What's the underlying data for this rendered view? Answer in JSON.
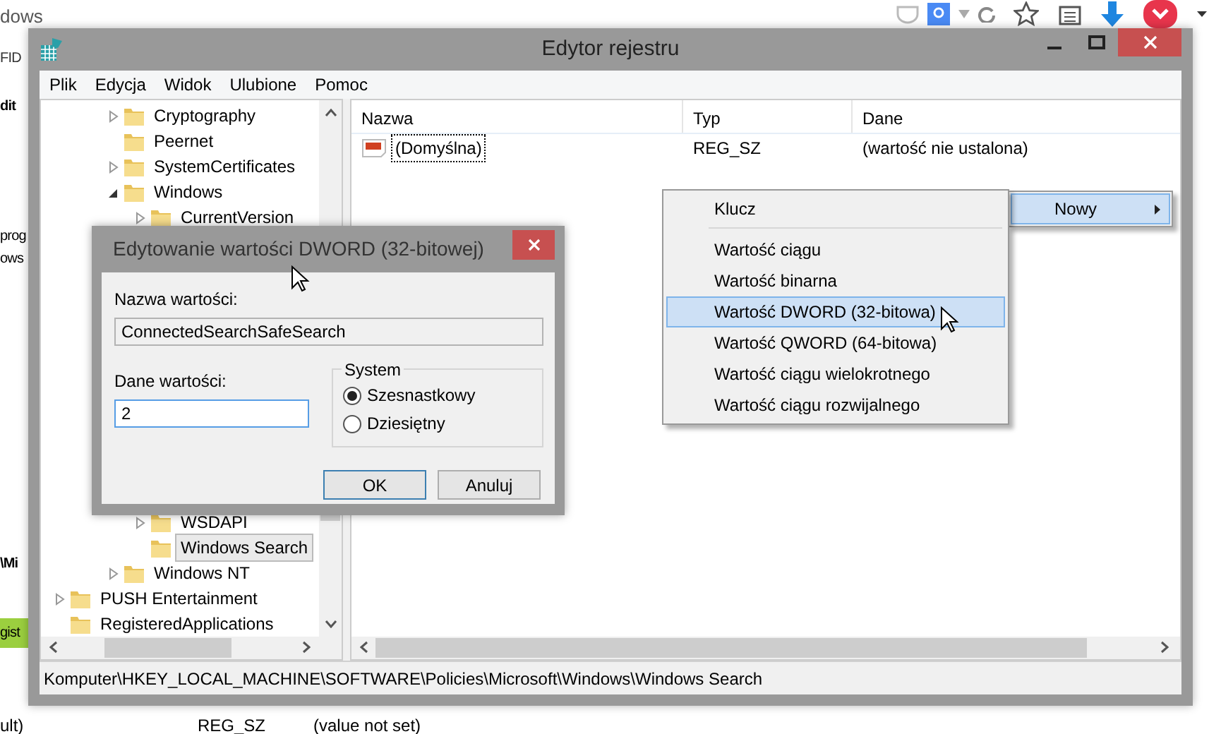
{
  "browser": {
    "title_fragment": "dows",
    "fragments": [
      {
        "text": "FID",
        "kind": "brand"
      },
      {
        "text": "dit",
        "kind": "heading"
      },
      {
        "text": "prog",
        "kind": "text"
      },
      {
        "text": "ows",
        "kind": "text"
      },
      {
        "text": "\\Mi",
        "kind": "heading"
      },
      {
        "text": "gist",
        "kind": "button"
      }
    ],
    "bottom_row": [
      "ult)",
      "REG_SZ",
      "(value not set)"
    ]
  },
  "window": {
    "title": "Edytor rejestru"
  },
  "menu": [
    "Plik",
    "Edycja",
    "Widok",
    "Ulubione",
    "Pomoc"
  ],
  "tree": [
    {
      "children": [
        {
          "children": [
            {
              "label": "Cryptography",
              "expanded": false,
              "selected": false
            },
            {
              "label": "Peernet",
              "selected": false
            },
            {
              "label": "SystemCertificates",
              "expanded": false,
              "selected": false
            },
            {
              "label": "Windows",
              "expanded": true,
              "selected": false,
              "children": [
                {
                  "label": "CurrentVersion",
                  "expanded": false,
                  "selected": false
                },
                {
                  "label": "WSDAPI",
                  "expanded": false,
                  "selected": false
                },
                {
                  "label": "Windows Search",
                  "selected": true
                }
              ]
            },
            {
              "label": "Windows NT",
              "expanded": false,
              "selected": false
            }
          ]
        }
      ]
    },
    {
      "label": "PUSH Entertainment",
      "expanded": false,
      "selected": false
    },
    {
      "label": "RegisteredApplications",
      "selected": false
    }
  ],
  "list": {
    "columns": [
      "Nazwa",
      "Typ",
      "Dane"
    ],
    "rows": [
      {
        "name": "(Domyślna)",
        "type": "REG_SZ",
        "data": "(wartość nie ustalona)",
        "focused": true
      }
    ]
  },
  "context_menu": {
    "item": {
      "label": "Nowy",
      "selected": true
    },
    "submenu": [
      {
        "kind": "item",
        "label": "Klucz",
        "selected": false
      },
      {
        "kind": "separator"
      },
      {
        "kind": "item",
        "label": "Wartość ciągu",
        "selected": false
      },
      {
        "kind": "item",
        "label": "Wartość binarna",
        "selected": false
      },
      {
        "kind": "item",
        "label": "Wartość DWORD (32-bitowa)",
        "selected": true
      },
      {
        "kind": "item",
        "label": "Wartość QWORD (64-bitowa)",
        "selected": false
      },
      {
        "kind": "item",
        "label": "Wartość ciągu wielokrotnego",
        "selected": false
      },
      {
        "kind": "item",
        "label": "Wartość ciągu rozwijalnego",
        "selected": false
      }
    ]
  },
  "status_bar": "Komputer\\HKEY_LOCAL_MACHINE\\SOFTWARE\\Policies\\Microsoft\\Windows\\Windows Search",
  "dialog": {
    "title": "Edytowanie wartości DWORD (32-bitowej)",
    "name_label": "Nazwa wartości:",
    "name_value": "ConnectedSearchSafeSearch",
    "data_label": "Dane wartości:",
    "data_value": "2",
    "base_group": "System",
    "bases": [
      {
        "label": "Szesnastkowy",
        "selected": true
      },
      {
        "label": "Dziesiętny",
        "selected": false
      }
    ],
    "buttons": [
      {
        "label": "OK",
        "default": true
      },
      {
        "label": "Anuluj",
        "default": false
      }
    ]
  }
}
